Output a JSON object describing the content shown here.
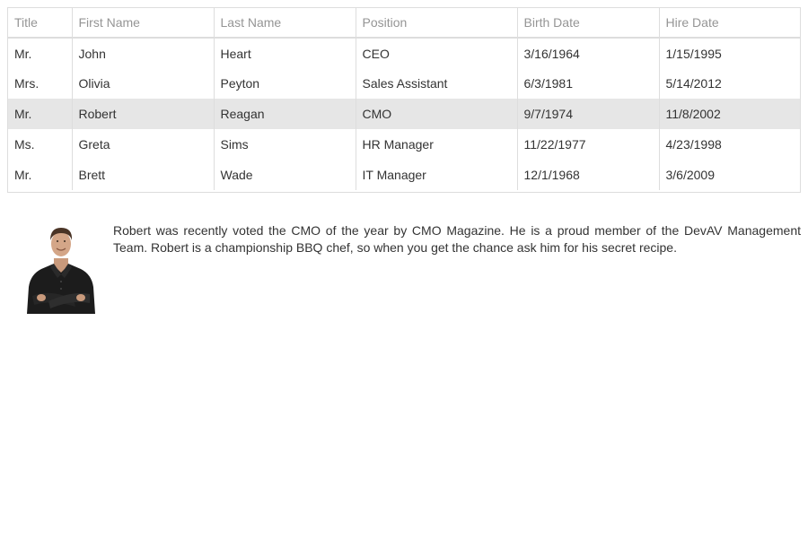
{
  "grid": {
    "columns": [
      "Title",
      "First Name",
      "Last Name",
      "Position",
      "Birth Date",
      "Hire Date"
    ],
    "rows": [
      [
        "Mr.",
        "John",
        "Heart",
        "CEO",
        "3/16/1964",
        "1/15/1995"
      ],
      [
        "Mrs.",
        "Olivia",
        "Peyton",
        "Sales Assistant",
        "6/3/1981",
        "5/14/2012"
      ],
      [
        "Mr.",
        "Robert",
        "Reagan",
        "CMO",
        "9/7/1974",
        "11/8/2002"
      ],
      [
        "Ms.",
        "Greta",
        "Sims",
        "HR Manager",
        "11/22/1977",
        "4/23/1998"
      ],
      [
        "Mr.",
        "Brett",
        "Wade",
        "IT Manager",
        "12/1/1968",
        "3/6/2009"
      ]
    ],
    "selected_row_index": 2
  },
  "detail": {
    "notes": "Robert was recently voted the CMO of the year by CMO Magazine. He is a proud member of the DevAV Management Team. Robert is a championship BBQ chef, so when you get the chance ask him for his secret recipe.",
    "photo_icon": "employee-photo"
  },
  "colors": {
    "header_text": "#959595",
    "border": "#dddddd",
    "selected_row": "#e6e6e6",
    "text": "#333333"
  }
}
